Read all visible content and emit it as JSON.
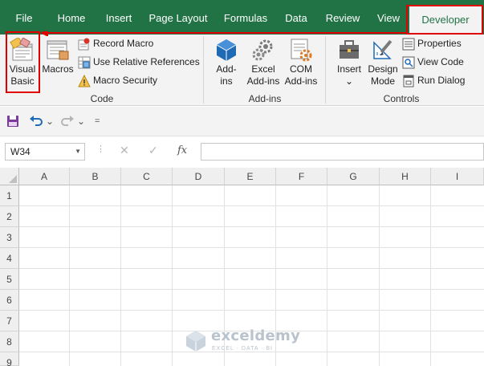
{
  "tabs": [
    {
      "label": "File"
    },
    {
      "label": "Home"
    },
    {
      "label": "Insert"
    },
    {
      "label": "Page Layout"
    },
    {
      "label": "Formulas"
    },
    {
      "label": "Data"
    },
    {
      "label": "Review"
    },
    {
      "label": "View"
    },
    {
      "label": "Developer",
      "active": true
    }
  ],
  "ribbon": {
    "code": {
      "visual_basic_line1": "Visual",
      "visual_basic_line2": "Basic",
      "macros": "Macros",
      "record_macro": "Record Macro",
      "relative_refs": "Use Relative References",
      "macro_security": "Macro Security",
      "group_label": "Code"
    },
    "addins": {
      "addins_line1": "Add-",
      "addins_line2": "ins",
      "excel_addins_line1": "Excel",
      "excel_addins_line2": "Add-ins",
      "com_addins_line1": "COM",
      "com_addins_line2": "Add-ins",
      "group_label": "Add-ins"
    },
    "controls": {
      "insert": "Insert",
      "insert_caret": "⌄",
      "design_line1": "Design",
      "design_line2": "Mode",
      "properties": "Properties",
      "view_code": "View Code",
      "run_dialog": "Run Dialog",
      "group_label": "Controls"
    }
  },
  "qat": {
    "undo_caret": "⌄",
    "redo_caret": "⌄",
    "customize": "="
  },
  "formula_bar": {
    "name_box": "W34",
    "name_box_caret": "▼",
    "dots": "⋮",
    "cancel": "✕",
    "enter": "✓",
    "fx": "fx",
    "formula": ""
  },
  "grid": {
    "columns": [
      "A",
      "B",
      "C",
      "D",
      "E",
      "F",
      "G",
      "H",
      "I"
    ],
    "rows": [
      "1",
      "2",
      "3",
      "4",
      "5",
      "6",
      "7",
      "8",
      "9"
    ]
  },
  "watermark": {
    "name": "exceldemy",
    "tagline": "EXCEL · DATA · BI"
  },
  "colors": {
    "excel_green": "#217346",
    "highlight_red": "#e00000",
    "ribbon_bg": "#f3f3f3",
    "icon_blue": "#1f6ab5"
  }
}
